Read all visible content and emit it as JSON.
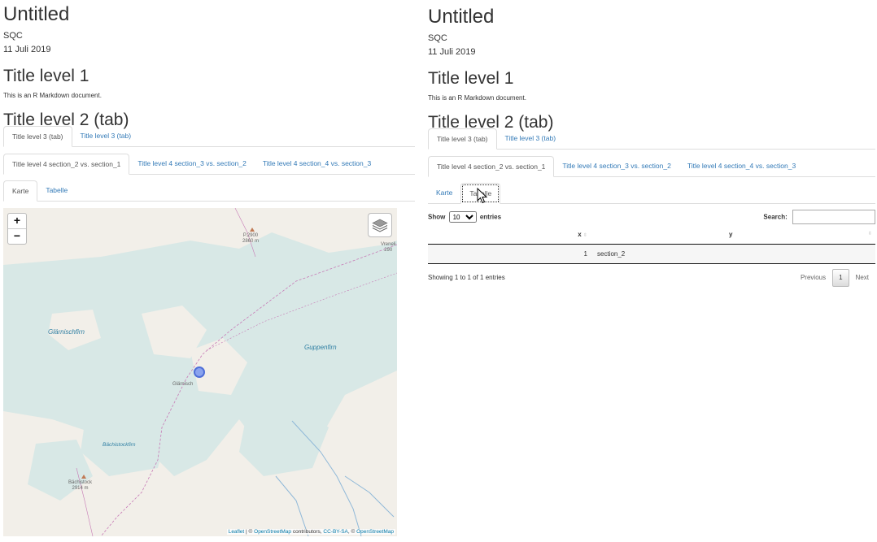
{
  "left": {
    "doc_title": "Untitled",
    "author": "SQC",
    "date": "11 Juli 2019",
    "h1": "Title level 1",
    "paragraph": "This is an R Markdown document.",
    "h2": "Title level 2 (tab)",
    "tabs_l3": [
      {
        "label": "Title level 3 (tab)",
        "active": true
      },
      {
        "label": "Title level 3 (tab)",
        "active": false
      }
    ],
    "tabs_l4": [
      {
        "label": "Title level 4 section_2 vs. section_1",
        "active": true
      },
      {
        "label": "Title level 4 section_3 vs. section_2",
        "active": false
      },
      {
        "label": "Title level 4 section_4 vs. section_3",
        "active": false
      }
    ],
    "tabs_l5": [
      {
        "label": "Karte",
        "active": true
      },
      {
        "label": "Tabelle",
        "active": false
      }
    ],
    "map": {
      "zoom_in": "+",
      "zoom_out": "−",
      "labels": {
        "glarnischfirn": "Glärnischfirn",
        "guppenfirn": "Guppenfirn",
        "bachistockfirn": "Bächistockfirn",
        "glarnisch": "Glärnisch",
        "peak_p": "P.2900",
        "peak_p_alt": "2860 m",
        "bachistock": "Bächistock",
        "bachistock_alt": "2914 m",
        "vrenelisgartli": "Vreneli",
        "vrenelis_alt": "290"
      },
      "attribution": {
        "leaflet": "Leaflet",
        "sep": " | © ",
        "osm1": "OpenStreetMap",
        "contributors": " contributors, ",
        "license": "CC-BY-SA",
        "sep2": ", © ",
        "osm2": "OpenStreetMap"
      },
      "colors": {
        "land": "#f2efe9",
        "glacier": "#d8e8e6",
        "marker": "#5b7fe0",
        "trail": "#c77bb6",
        "stream": "#8fb8d8"
      }
    }
  },
  "right": {
    "doc_title": "Untitled",
    "author": "SQC",
    "date": "11 Juli 2019",
    "h1": "Title level 1",
    "paragraph": "This is an R Markdown document.",
    "h2": "Title level 2 (tab)",
    "tabs_l3": [
      {
        "label": "Title level 3 (tab)",
        "active": true
      },
      {
        "label": "Title level 3 (tab)",
        "active": false
      }
    ],
    "tabs_l4": [
      {
        "label": "Title level 4 section_2 vs. section_1",
        "active": true
      },
      {
        "label": "Title level 4 section_3 vs. section_2",
        "active": false
      },
      {
        "label": "Title level 4 section_4 vs. section_3",
        "active": false
      }
    ],
    "tabs_l5": [
      {
        "label": "Karte",
        "active": false
      },
      {
        "label": "Tabelle",
        "active": true
      }
    ],
    "table": {
      "show_label": "Show",
      "length_value": "10",
      "entries_label": "entries",
      "search_label": "Search:",
      "search_value": "",
      "columns": [
        "x",
        "y"
      ],
      "rows": [
        {
          "index": "1",
          "y": "section_2"
        }
      ],
      "info": "Showing 1 to 1 of 1 entries",
      "previous": "Previous",
      "page": "1",
      "next": "Next"
    }
  }
}
